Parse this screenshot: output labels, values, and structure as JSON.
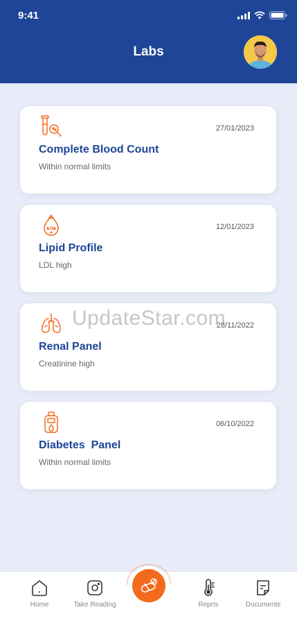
{
  "status_bar": {
    "time": "9:41"
  },
  "header": {
    "title": "Labs"
  },
  "labs": [
    {
      "icon": "test-tube-magnifier-icon",
      "date": "27/01/2023",
      "title": "Complete Blood Count",
      "subtitle": "Within normal limits"
    },
    {
      "icon": "ldl-blood-drop-icon",
      "date": "12/01/2023",
      "title": "Lipid Profile",
      "subtitle": "LDL high"
    },
    {
      "icon": "lungs-icon",
      "date": "28/11/2022",
      "title": "Renal Panel",
      "subtitle": "Creatinine high"
    },
    {
      "icon": "glucose-meter-icon",
      "date": "06/10/2022",
      "title": "Diabetes  Panel",
      "subtitle": "Within normal limits"
    }
  ],
  "watermark": "UpdateStar.com",
  "tabbar": {
    "home": "Home",
    "take_reading": "Take Reading",
    "reports": "Reprts",
    "documents": "Documents"
  },
  "colors": {
    "brand": "#1e4597",
    "accent": "#f26b1d",
    "background": "#e8ecf8"
  }
}
